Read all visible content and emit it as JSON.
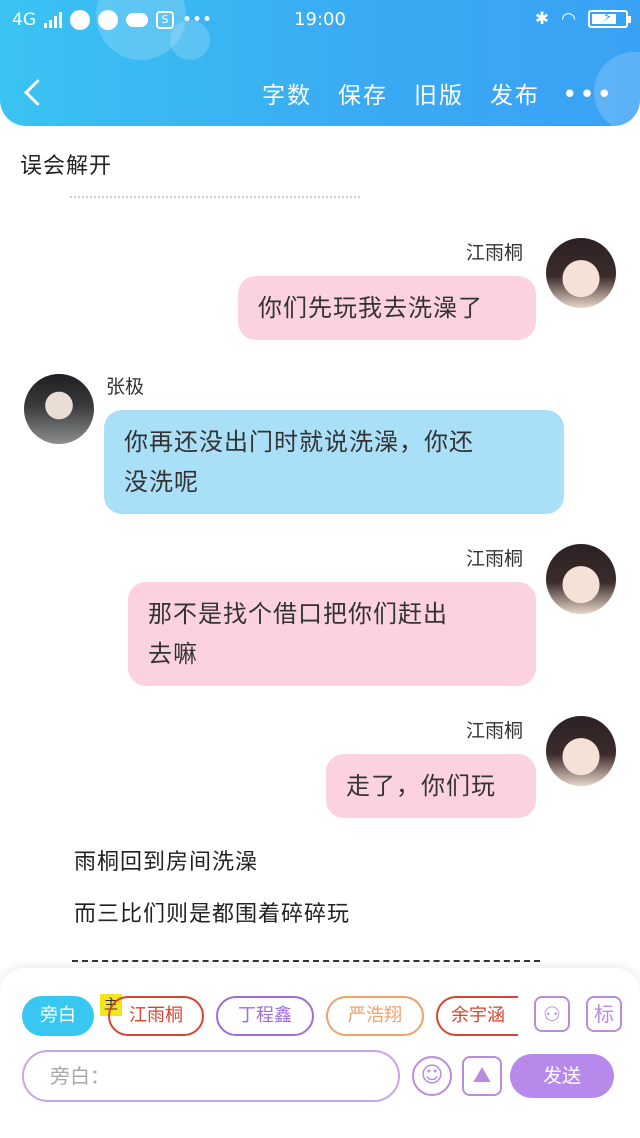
{
  "status_bar": {
    "network": "4G",
    "time": "19:00",
    "battery_level": 0.75
  },
  "nav": {
    "actions": [
      "字数",
      "保存",
      "旧版",
      "发布"
    ],
    "more": "•••"
  },
  "content": {
    "narration_top": "误会解开",
    "messages": [
      {
        "sender": "江雨桐",
        "text": "你们先玩我去洗澡了"
      },
      {
        "sender": "张极",
        "text_line1": "你再还没出门时就说洗澡，你还",
        "text_line2": "没洗呢"
      },
      {
        "sender": "江雨桐",
        "text_line1": "那不是找个借口把你们赶出",
        "text_line2": "去嘛"
      },
      {
        "sender": "江雨桐",
        "text": "走了，你们玩"
      }
    ],
    "narration_1": "雨桐回到房间洗澡",
    "narration_2": "而三比们则是都围着碎碎玩"
  },
  "editor": {
    "chips": [
      "旁白",
      "江雨桐",
      "丁程鑫",
      "严浩翔",
      "余宇涵"
    ],
    "main_tag": "主",
    "tag_icon": "标",
    "input_placeholder": "旁白：",
    "send_label": "发送",
    "colors": {
      "accent": "#38c7f1",
      "purple": "#b689ea",
      "chip_red": "#d6452f",
      "chip_purple": "#a06dd8",
      "chip_orange": "#f0a069"
    }
  }
}
